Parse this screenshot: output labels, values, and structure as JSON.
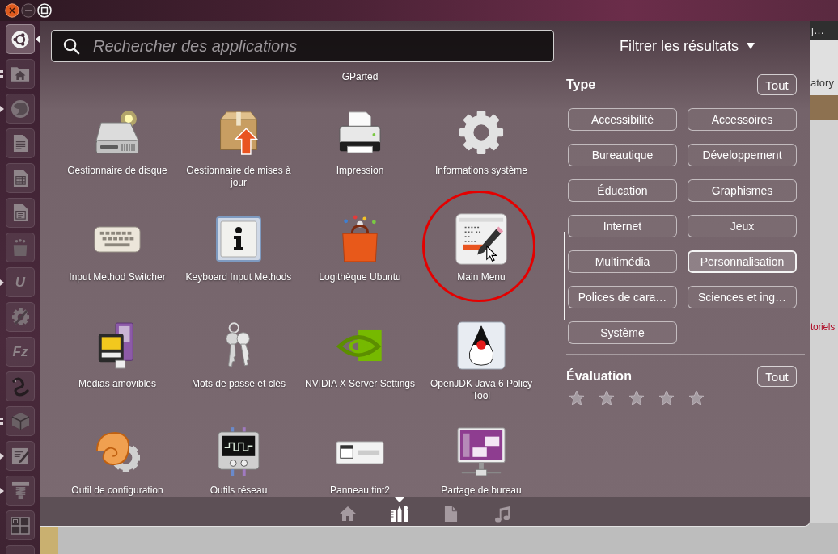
{
  "launcher": [
    {
      "active": true,
      "running": false
    },
    {
      "active": false,
      "running": true,
      "multiple": true
    },
    {
      "active": false,
      "running": true,
      "multiple": false
    },
    {
      "active": false,
      "running": false
    },
    {
      "active": false,
      "running": false
    },
    {
      "active": false,
      "running": false
    },
    {
      "active": false,
      "running": false
    },
    {
      "active": false,
      "running": true,
      "multiple": false,
      "logo_text": "U"
    },
    {
      "active": false,
      "running": false
    },
    {
      "active": false,
      "running": false,
      "logo_text": "Fz"
    },
    {
      "active": false,
      "running": false
    },
    {
      "active": false,
      "running": true,
      "multiple": true
    },
    {
      "active": false,
      "running": true,
      "multiple": false
    },
    {
      "active": false,
      "running": true,
      "multiple": false
    },
    {
      "active": false,
      "running": false
    },
    {
      "active": false,
      "running": false
    }
  ],
  "search": {
    "placeholder": "Rechercher des applications"
  },
  "apps": {
    "clipped_label": "GParted",
    "items": [
      {
        "label": "Gestionnaire de disque",
        "circled": false
      },
      {
        "label": "Gestionnaire de mises à jour",
        "circled": false
      },
      {
        "label": "Impression",
        "circled": false
      },
      {
        "label": "Informations système",
        "circled": false
      },
      {
        "label": "Input Method Switcher",
        "circled": false
      },
      {
        "label": "Keyboard Input Methods",
        "circled": false
      },
      {
        "label": "Logithèque Ubuntu",
        "circled": false
      },
      {
        "label": "Main Menu",
        "circled": true
      },
      {
        "label": "Médias amovibles",
        "circled": false
      },
      {
        "label": "Mots de passe et clés",
        "circled": false
      },
      {
        "label": "NVIDIA X Server Settings",
        "circled": false
      },
      {
        "label": "OpenJDK Java 6 Policy Tool",
        "circled": false
      },
      {
        "label": "Outil de configuration",
        "circled": false
      },
      {
        "label": "Outils réseau",
        "circled": false
      },
      {
        "label": "Panneau tint2",
        "circled": false
      },
      {
        "label": "Partage de bureau",
        "circled": false
      }
    ]
  },
  "filters": {
    "title": "Filtrer les résultats",
    "expanded": true,
    "type": {
      "heading": "Type",
      "all_button": "Tout",
      "categories": [
        {
          "label": "Accessibilité",
          "selected": false
        },
        {
          "label": "Accessoires",
          "selected": false
        },
        {
          "label": "Bureautique",
          "selected": false
        },
        {
          "label": "Développement",
          "selected": false
        },
        {
          "label": "Éducation",
          "selected": false
        },
        {
          "label": "Graphismes",
          "selected": false
        },
        {
          "label": "Internet",
          "selected": false
        },
        {
          "label": "Jeux",
          "selected": false
        },
        {
          "label": "Multimédia",
          "selected": false
        },
        {
          "label": "Personnalisation",
          "selected": true
        },
        {
          "label": "Polices de cara…",
          "selected": false
        },
        {
          "label": "Sciences et ing…",
          "selected": false
        },
        {
          "label": "Système",
          "selected": false
        }
      ]
    },
    "rating": {
      "heading": "Évaluation",
      "all_button": "Tout",
      "stars": 0
    }
  },
  "lenses": [
    {
      "selected": false
    },
    {
      "selected": true
    },
    {
      "selected": false
    },
    {
      "selected": false
    }
  ],
  "background_window": {
    "tab_title": "j…",
    "fragments": [
      {
        "kind": "text",
        "text": "atory"
      },
      {
        "kind": "link",
        "text": "toriels"
      }
    ]
  }
}
